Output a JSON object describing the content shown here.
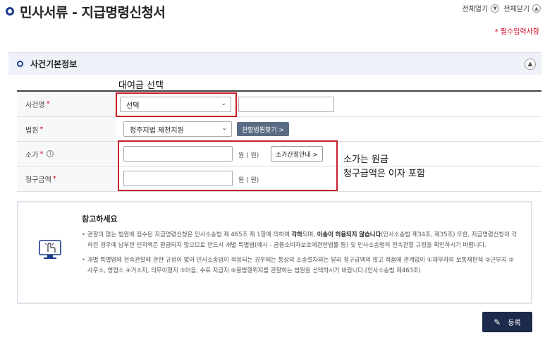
{
  "header": {
    "title": "민사서류 - 지급명령신청서",
    "expand_all": "전체열기",
    "collapse_all": "전체닫기",
    "required_note": "* 필수입력사항"
  },
  "section": {
    "title": "사건기본정보"
  },
  "annotations": {
    "select_hint": "대여금 선택",
    "amount_hint_1": "소가는 원금",
    "amount_hint_2": "청구금액은 이자 포함"
  },
  "form": {
    "case_name": {
      "label": "사건명",
      "required": "*",
      "selected": "선택"
    },
    "court": {
      "label": "법원",
      "required": "*",
      "selected": "청주지법 제천지원",
      "find_button": "관할법원찾기 >"
    },
    "claim_value": {
      "label": "소가",
      "required": "*",
      "info_icon": "i",
      "unit": "원  ( 원)",
      "guide_button": "소가산정안내 >"
    },
    "claim_amount": {
      "label": "청구금액",
      "required": "*",
      "unit": "원  ( 원)"
    }
  },
  "notice": {
    "title": "참고하세요",
    "item1_a": "관할이 없는 법원에 접수된 지급명령신청은 민사소송법 제 465조 제 1항에 의하여 ",
    "item1_b": "각하",
    "item1_c": "되며, ",
    "item1_d": "이송이 허용되지 않습니다",
    "item1_e": "(민사소송법 제34조, 제35조) 또한, 지급명령신청이 각하된 경우에 납부한 인지액은 환급되지 않으므로 반드시 개별 특별법(예시 - 금융소비자보호에관한법률 등) 및 민사소송법의 전속관할 규정을 확인하시기 바랍니다.",
    "item2": "개별 특별법에 전속관할에 관한 규정이 없어 민사소송법이 적용되는 경우에는 통상의 소송절차와는 달리 청구금액의 많고 적음에 관계없이 ①채무자의 보통재판적 ②근무지 ③사무소, 영업소 ④거소지, 의무이행지 ⑤어음, 수표 지급지 ⑥불법행위지를 관할하는 법원을 선택하시기 바랍니다.(민사소송법 제463조)"
  },
  "actions": {
    "submit": "등록"
  },
  "icons": {
    "toggle_expand": "chevron-down-icon",
    "toggle_collapse": "chevron-up-icon",
    "select_arrow": "chevron-down-icon",
    "notice": "touch-screen-icon",
    "submit": "pencil-icon"
  },
  "colors": {
    "brand": "#1a3c8c",
    "required": "#d0021b",
    "annotation_box": "#c8202a",
    "submit_bg": "#1c2b4c",
    "secondary_button": "#5a6c84"
  }
}
